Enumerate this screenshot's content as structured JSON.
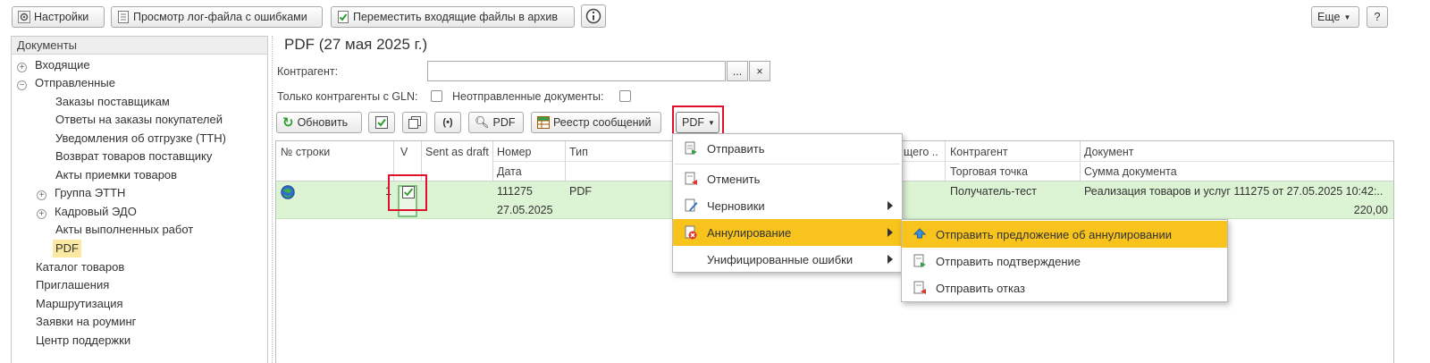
{
  "toolbar": {
    "settings": "Настройки",
    "view_log": "Просмотр лог-файла с ошибками",
    "archive": "Переместить входящие файлы в архив",
    "more": "Еще",
    "help": "?"
  },
  "nav": {
    "header": "Документы",
    "items": [
      {
        "label": "Входящие",
        "toggle": "+"
      },
      {
        "label": "Отправленные",
        "toggle": "−"
      },
      {
        "label": "Заказы поставщикам"
      },
      {
        "label": "Ответы на заказы покупателей"
      },
      {
        "label": "Уведомления об отгрузке (ТТН)"
      },
      {
        "label": "Возврат товаров поставщику"
      },
      {
        "label": "Акты приемки товаров"
      },
      {
        "label": "Группа ЭТТН",
        "toggle": "+"
      },
      {
        "label": "Кадровый ЭДО",
        "toggle": "+"
      },
      {
        "label": "Акты выполненных работ"
      },
      {
        "label": "PDF"
      },
      {
        "label": "Каталог товаров"
      },
      {
        "label": "Приглашения"
      },
      {
        "label": "Маршрутизация"
      },
      {
        "label": "Заявки на роуминг"
      },
      {
        "label": "Центр поддержки"
      }
    ]
  },
  "main": {
    "title": "PDF (27 мая 2025 г.)",
    "counterparty_label": "Контрагент:",
    "counterparty_value": "",
    "ellipsis": "...",
    "clear": "×",
    "gln_label": "Только контрагенты с GLN:",
    "unsent_label": "Неотправленные документы:",
    "buttons": {
      "refresh": "Обновить",
      "pdf": "PDF",
      "registry": "Реестр сообщений",
      "pdf_menu": "PDF"
    }
  },
  "table": {
    "headers": {
      "row_no": "№ строки",
      "v": "V",
      "sent_as_draft": "Sent as draft",
      "number": "Номер",
      "date": "Дата",
      "type": "Тип",
      "partial": "щего ..",
      "counterparty": "Контрагент",
      "outlet": "Торговая точка",
      "document": "Документ",
      "doc_sum": "Сумма документа"
    },
    "row": {
      "row_no": "1",
      "number": "111275",
      "date": "27.05.2025",
      "type": "PDF",
      "counterparty": "Получатель-тест",
      "document": "Реализация товаров и услуг 111275 от 27.05.2025 10:42:..",
      "sum": "220,00"
    }
  },
  "menu": {
    "send": "Отправить",
    "cancel": "Отменить",
    "drafts": "Черновики",
    "annul": "Аннулирование",
    "unified_errors": "Унифицированные ошибки"
  },
  "submenu": {
    "send_annul_offer": "Отправить предложение об аннулировании",
    "send_confirm": "Отправить подтверждение",
    "send_refusal": "Отправить отказ"
  },
  "colors": {
    "highlight": "#f7c31c",
    "row_bg": "#dcf3d4",
    "selected_nav": "#fbe9a1",
    "annotation": "#e0102a"
  }
}
